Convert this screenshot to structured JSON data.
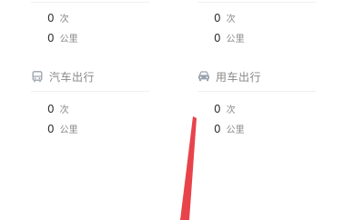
{
  "cards": [
    {
      "id": "top-left",
      "count_value": "0",
      "count_unit": "次",
      "distance_value": "0",
      "distance_unit": "公里"
    },
    {
      "id": "top-right",
      "count_value": "0",
      "count_unit": "次",
      "distance_value": "0",
      "distance_unit": "公里"
    },
    {
      "id": "bus",
      "title": "汽车出行",
      "icon": "bus-icon",
      "count_value": "0",
      "count_unit": "次",
      "distance_value": "0",
      "distance_unit": "公里"
    },
    {
      "id": "car",
      "title": "用车出行",
      "icon": "car-icon",
      "count_value": "0",
      "count_unit": "次",
      "distance_value": "0",
      "distance_unit": "公里"
    }
  ],
  "colors": {
    "text": "#333333",
    "muted": "#888888",
    "divider": "#f0f0f0",
    "arrow": "#e8434b"
  }
}
